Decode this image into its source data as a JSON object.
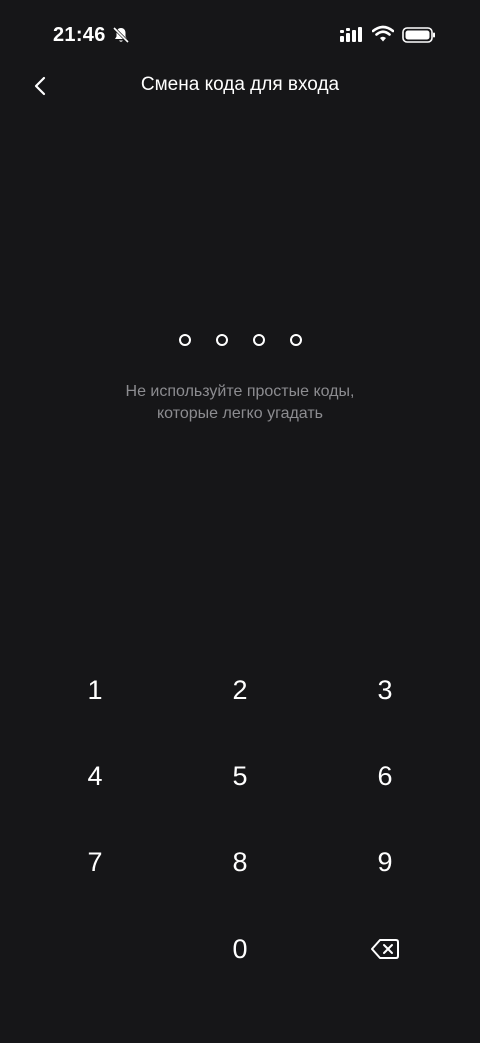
{
  "status_bar": {
    "time": "21:46",
    "icons": [
      "bell-off-icon",
      "signal-icon",
      "wifi-icon",
      "battery-icon"
    ]
  },
  "header": {
    "title": "Смена кода для входа",
    "back_icon": "chevron-left-icon"
  },
  "pin": {
    "length": 4,
    "entered": 0
  },
  "hint": "Не используйте простые коды,\nкоторые легко угадать",
  "keypad": {
    "keys": [
      "1",
      "2",
      "3",
      "4",
      "5",
      "6",
      "7",
      "8",
      "9",
      "0"
    ],
    "backspace_icon": "backspace-icon"
  },
  "colors": {
    "background": "#161618",
    "text": "#ffffff",
    "hint": "#8c8c90"
  }
}
